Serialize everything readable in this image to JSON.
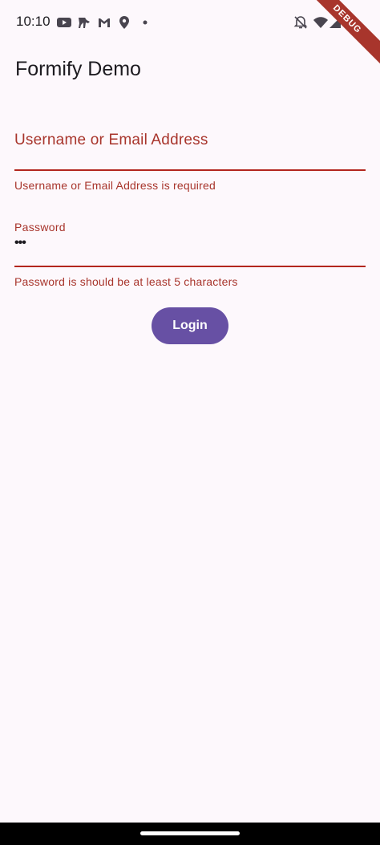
{
  "status_bar": {
    "time": "10:10",
    "left_icons": [
      "youtube-icon",
      "tool-icon",
      "gmail-icon",
      "location-pin-icon",
      "dot-icon"
    ],
    "right_icons": [
      "notifications-off-icon",
      "wifi-icon",
      "cell-signal-icon",
      "battery-icon"
    ]
  },
  "debug_banner": "DEBUG",
  "app_bar": {
    "title": "Formify Demo"
  },
  "form": {
    "username": {
      "label": "Username or Email Address",
      "value": "",
      "error": "Username or Email Address is required"
    },
    "password": {
      "label": "Password",
      "value": "•••",
      "error": "Password is should be at least 5 characters"
    },
    "submit_label": "Login"
  },
  "colors": {
    "background": "#fdf8fc",
    "error": "#b3261e",
    "primary": "#6750a4",
    "text": "#1d1b20"
  }
}
